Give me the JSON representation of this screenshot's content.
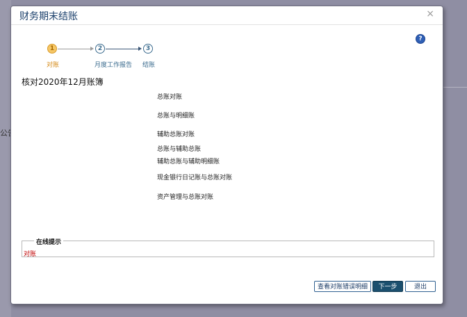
{
  "background": {
    "partial_text": "公告"
  },
  "dialog": {
    "title": "财务期末结账",
    "close_glyph": "×",
    "help_glyph": "?"
  },
  "steps": [
    {
      "number": "1",
      "label": "对账",
      "state": "active",
      "color": "#d58a16"
    },
    {
      "number": "2",
      "label": "月度工作报告",
      "state": "pending",
      "color": "#3a6b8e"
    },
    {
      "number": "3",
      "label": "结账",
      "state": "pending",
      "color": "#3a6b8e"
    }
  ],
  "heading": "核对2020年12月账簿",
  "check_items": [
    "总账对账",
    "总账与明细账",
    "辅助总账对账",
    "总账与辅助总账",
    "辅助总账与辅助明细账",
    "现金银行日记账与总账对账",
    "资产管理与总账对账"
  ],
  "online_hint": {
    "legend": "在线提示",
    "text": "对账",
    "text_color": "#c00000"
  },
  "buttons": {
    "view_errors": "查看对账错误明细",
    "next": "下一步",
    "exit": "退出"
  }
}
